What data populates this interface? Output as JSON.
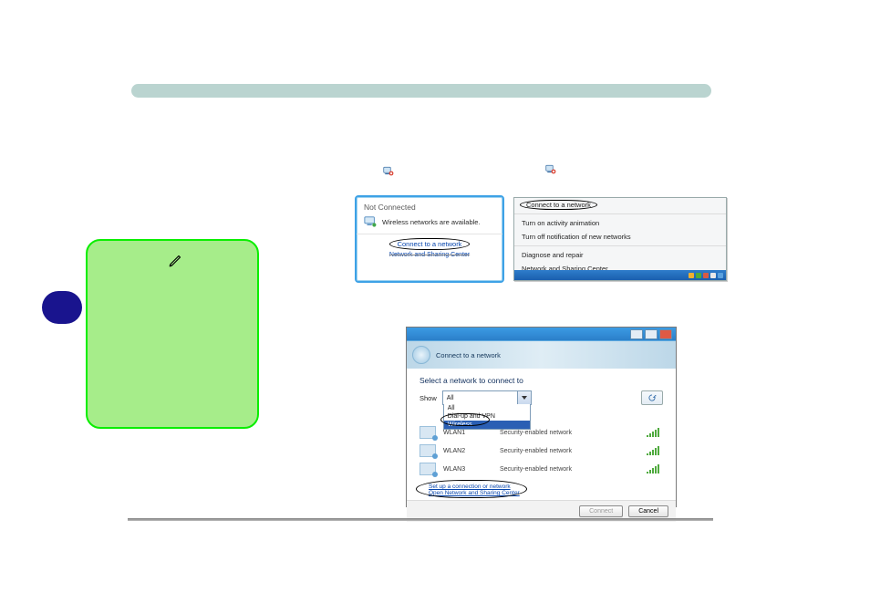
{
  "icons": {
    "network_error": "network-error-icon",
    "pen": "pen-icon",
    "computer": "computer-icon"
  },
  "popup_not_connected": {
    "title": "Not Connected",
    "message": "Wireless networks are available.",
    "link_connect": "Connect to a network",
    "link_center": "Network and Sharing Center"
  },
  "context_menu": {
    "item_connect": "Connect to a network",
    "item_anim": "Turn on activity animation",
    "item_notif": "Turn off notification of new networks",
    "item_diag": "Diagnose and repair",
    "item_center": "Network and Sharing Center"
  },
  "dialog": {
    "window_title": "Connect to a network",
    "heading": "Select a network to connect to",
    "show_label": "Show",
    "show_value": "All",
    "show_options": [
      "All",
      "Dial-up and VPN",
      "Wireless"
    ],
    "networks": [
      {
        "name": "WLAN1",
        "desc": "Security-enabled network"
      },
      {
        "name": "WLAN2",
        "desc": "Security-enabled network"
      },
      {
        "name": "WLAN3",
        "desc": "Security-enabled network"
      }
    ],
    "link_setup": "Set up a connection or network",
    "link_open_center": "Open Network and Sharing Center",
    "btn_connect": "Connect",
    "btn_cancel": "Cancel"
  }
}
